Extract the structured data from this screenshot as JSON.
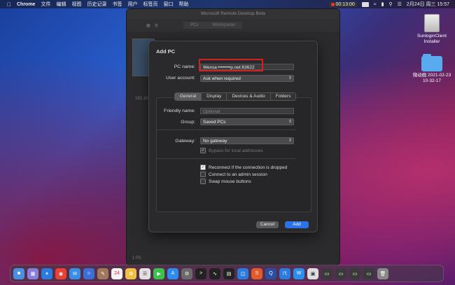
{
  "menubar": {
    "apple": "",
    "app": "Chrome",
    "menus": [
      "文件",
      "编辑",
      "视图",
      "历史记录",
      "书签",
      "用户",
      "标签页",
      "窗口",
      "帮助"
    ],
    "recording_time": "00:13:00",
    "datetime": "2月24日 周三  15:57"
  },
  "desktop": {
    "disk_label": "SunloginClient Installer",
    "folder_label": "微动画 2021-02-23 10-32-17"
  },
  "appwin": {
    "title": "Microsoft Remote Desktop Beta",
    "seg_pcs": "PCs",
    "seg_workspaces": "Workspaces",
    "thumb_label": "192.16...",
    "footer": "1 PC"
  },
  "sheet": {
    "title": "Add PC",
    "pc_name_label": "PC name:",
    "pc_name_value": "Wexsa ••••••••p.net:63622",
    "user_account_label": "User account:",
    "user_account_value": "Ask when required",
    "tabs": [
      "General",
      "Display",
      "Devices & Audio",
      "Folders"
    ],
    "friendly_name_label": "Friendly name:",
    "friendly_name_placeholder": "Optional",
    "group_label": "Group:",
    "group_value": "Saved PCs",
    "gateway_label": "Gateway:",
    "gateway_value": "No gateway",
    "bypass_label": "Bypass for local addresses",
    "reconnect_label": "Reconnect if the connection is dropped",
    "admin_label": "Connect to an admin session",
    "swap_label": "Swap mouse buttons",
    "cancel": "Cancel",
    "add": "Add"
  },
  "dock": {
    "calendar_day": "24"
  }
}
